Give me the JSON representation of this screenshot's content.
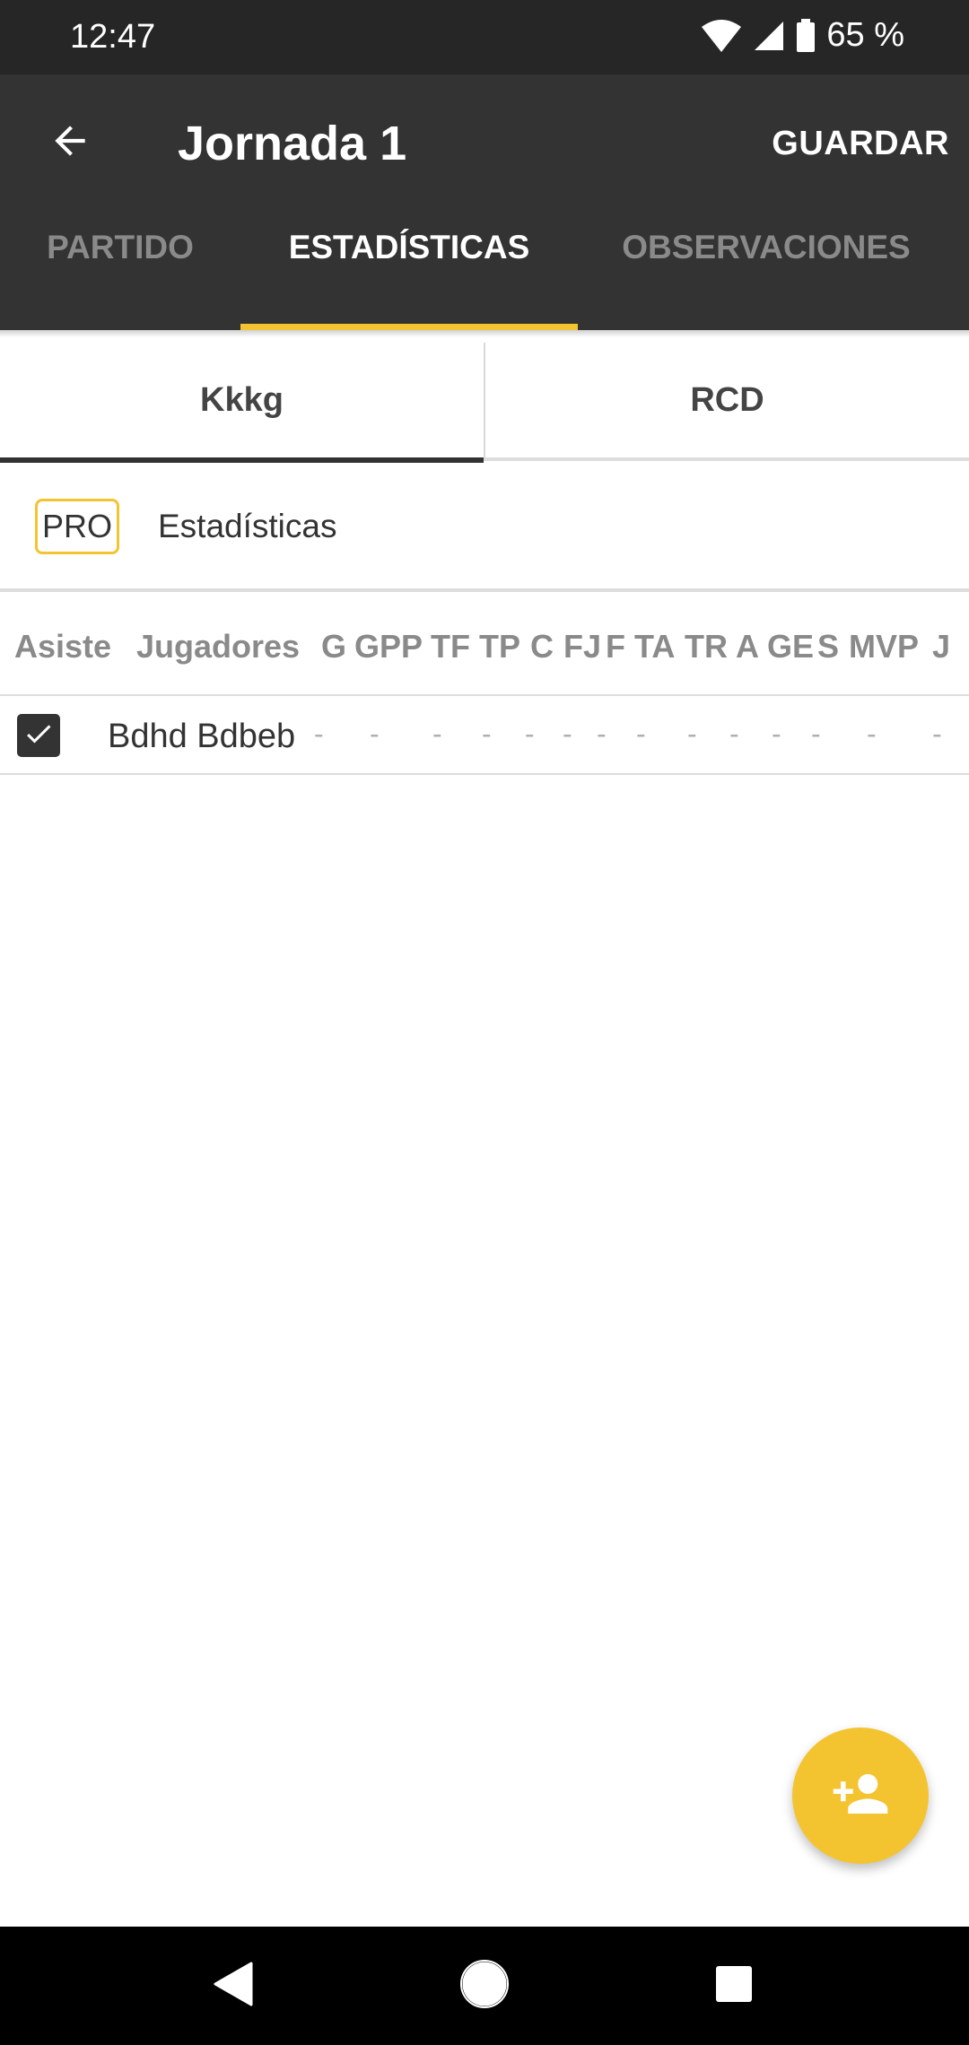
{
  "status": {
    "time": "12:47",
    "battery": "65 %"
  },
  "appbar": {
    "title": "Jornada 1",
    "save_label": "GUARDAR"
  },
  "tabs": [
    {
      "label": "PARTIDO",
      "active": false
    },
    {
      "label": "ESTADÍSTICAS",
      "active": true
    },
    {
      "label": "OBSERVACIONES",
      "active": false
    }
  ],
  "teams": [
    {
      "label": "Kkkg",
      "active": true
    },
    {
      "label": "RCD",
      "active": false
    }
  ],
  "pro": {
    "badge": "PRO",
    "label": "Estadísticas"
  },
  "table": {
    "headers": [
      "Asiste",
      "Jugadores",
      "G",
      "GPP",
      "TF",
      "TP",
      "C",
      "FJ",
      "F",
      "TA",
      "TR",
      "A",
      "GE",
      "S",
      "MVP",
      "J"
    ],
    "rows": [
      {
        "checked": true,
        "name": "Bdhd Bdbeb",
        "values": [
          "-",
          "-",
          "-",
          "-",
          "-",
          "-",
          "-",
          "-",
          "-",
          "-",
          "-",
          "-",
          "-",
          "-"
        ]
      }
    ]
  },
  "colors": {
    "accent": "#f4c430",
    "appbar": "#333333",
    "statusbar": "#262626"
  },
  "icons": {
    "back": "arrow-back-icon",
    "fab": "add-person-icon",
    "checkbox": "check-icon"
  }
}
